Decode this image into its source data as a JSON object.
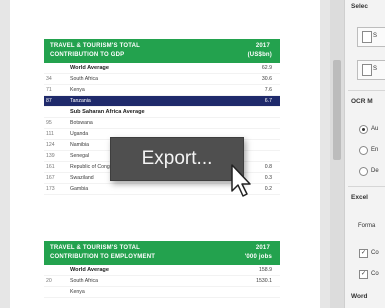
{
  "table1": {
    "title_line1": "TRAVEL & TOURISM'S TOTAL",
    "title_line2": "CONTRIBUTION TO GDP",
    "year": "2017",
    "unit": "(US$bn)",
    "rows": [
      {
        "rank": "",
        "country": "World Average",
        "value": "62.9",
        "style": "bold"
      },
      {
        "rank": "34",
        "country": "South Africa",
        "value": "30.6",
        "style": ""
      },
      {
        "rank": "71",
        "country": "Kenya",
        "value": "7.6",
        "style": ""
      },
      {
        "rank": "87",
        "country": "Tanzania",
        "value": "6.7",
        "style": "hl"
      },
      {
        "rank": "",
        "country": "Sub Saharan Africa Average",
        "value": "",
        "style": "bold"
      },
      {
        "rank": "95",
        "country": "Botswana",
        "value": "",
        "style": ""
      },
      {
        "rank": "111",
        "country": "Uganda",
        "value": "",
        "style": ""
      },
      {
        "rank": "124",
        "country": "Namibia",
        "value": "",
        "style": ""
      },
      {
        "rank": "139",
        "country": "Senegal",
        "value": "",
        "style": ""
      },
      {
        "rank": "161",
        "country": "Republic of Congo",
        "value": "0.8",
        "style": ""
      },
      {
        "rank": "167",
        "country": "Swaziland",
        "value": "0.3",
        "style": ""
      },
      {
        "rank": "173",
        "country": "Gambia",
        "value": "0.2",
        "style": ""
      }
    ]
  },
  "table2": {
    "title_line1": "TRAVEL & TOURISM'S TOTAL",
    "title_line2": "CONTRIBUTION TO EMPLOYMENT",
    "year": "2017",
    "unit": "'000 jobs",
    "rows": [
      {
        "rank": "",
        "country": "World Average",
        "value": "158.9",
        "style": "bold"
      },
      {
        "rank": "20",
        "country": "South Africa",
        "value": "1530.1",
        "style": ""
      },
      {
        "rank": "",
        "country": "Kenya",
        "value": "",
        "style": ""
      }
    ]
  },
  "tooltip": {
    "label": "Export..."
  },
  "panel": {
    "select_heading": "Selec",
    "btn1_label": "S",
    "btn2_label": "S",
    "ocr_heading": "OCR M",
    "opt_auto": "Au",
    "opt_en": "En",
    "opt_de": "De",
    "excel_heading": "Excel",
    "format_label": "Forma",
    "chk1_label": "Co",
    "chk2_label": "Co",
    "word_heading": "Word"
  },
  "colors": {
    "header_green": "#23a24e",
    "highlight_navy": "#1f2a6b",
    "tooltip_bg": "#4f4f4f"
  }
}
